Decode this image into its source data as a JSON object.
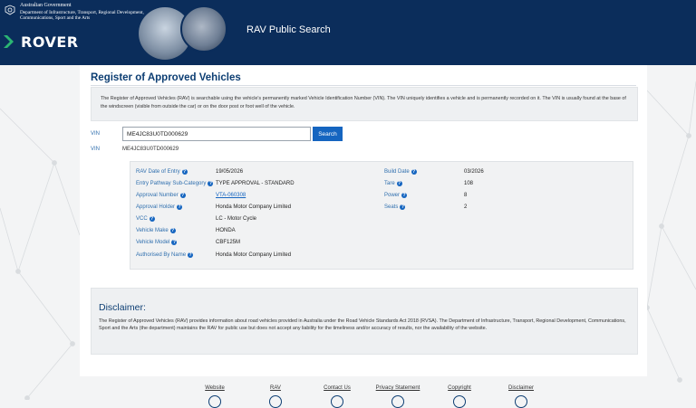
{
  "header": {
    "gov_line1": "Australian Government",
    "gov_line2": "Department of Infrastructure, Transport, Regional Development, Communications, Sport and the Arts",
    "logo_text": "ROVER",
    "site_title": "RAV Public Search"
  },
  "page": {
    "title": "Register of Approved Vehicles",
    "intro": "The Register of Approved Vehicles (RAV) is searchable using the vehicle's permanently marked Vehicle Identification Number (VIN). The VIN uniquely identifies a vehicle and is permanently recorded on it. The VIN is usually found at the base of the windscreen (visible from outside the car) or on the door post or foot well of the vehicle."
  },
  "search": {
    "vin_label": "VIN",
    "vin_value": "ME4JC83U0TD000629",
    "button_label": "Search",
    "result_label": "VIN",
    "result_value": "ME4JC83U0TD000629"
  },
  "details": {
    "left": [
      {
        "label": "RAV Date of Entry",
        "value": "19/05/2026",
        "help": true,
        "link": false
      },
      {
        "label": "Entry Pathway Sub-Category",
        "value": "TYPE APPROVAL - STANDARD",
        "help": true,
        "link": false
      },
      {
        "label": "Approval Number",
        "value": "VTA-060308",
        "help": true,
        "link": true
      },
      {
        "label": "Approval Holder",
        "value": "Honda Motor Company Limited",
        "help": true,
        "link": false
      },
      {
        "label": "VCC",
        "value": "LC - Motor Cycle",
        "help": true,
        "link": false
      },
      {
        "label": "Vehicle Make",
        "value": "HONDA",
        "help": true,
        "link": false
      },
      {
        "label": "Vehicle Model",
        "value": "CBF125M",
        "help": true,
        "link": false
      },
      {
        "label": "Authorised By Name",
        "value": "Honda Motor Company Limited",
        "help": true,
        "link": false
      }
    ],
    "right": [
      {
        "label": "Build Date",
        "value": "03/2026",
        "help": true
      },
      {
        "label": "Tare",
        "value": "108",
        "help": true
      },
      {
        "label": "Power",
        "value": "8",
        "help": true
      },
      {
        "label": "Seats",
        "value": "2",
        "help": true
      }
    ]
  },
  "disclaimer": {
    "title": "Disclaimer:",
    "text": "The Register of Approved Vehicles (RAV) provides information about road vehicles provided in Australia under the Road Vehicle Standards Act 2018 (RVSA). The Department of Infrastructure, Transport, Regional Development, Communications, Sport and the Arts (the department) maintains the RAV for public use but does not accept any liability for the timeliness and/or accuracy of results, nor the availability of the website."
  },
  "footer": {
    "links": [
      "Website",
      "RAV",
      "Contact Us",
      "Privacy Statement",
      "Copyright",
      "Disclaimer"
    ]
  },
  "colors": {
    "header_bg": "#0b2d5b",
    "accent": "#1565c0",
    "label_blue": "#2f6fae",
    "logo_green": "#2bb673"
  },
  "icons": [
    "crest-icon",
    "rover-chevron-icon",
    "help-icon"
  ]
}
